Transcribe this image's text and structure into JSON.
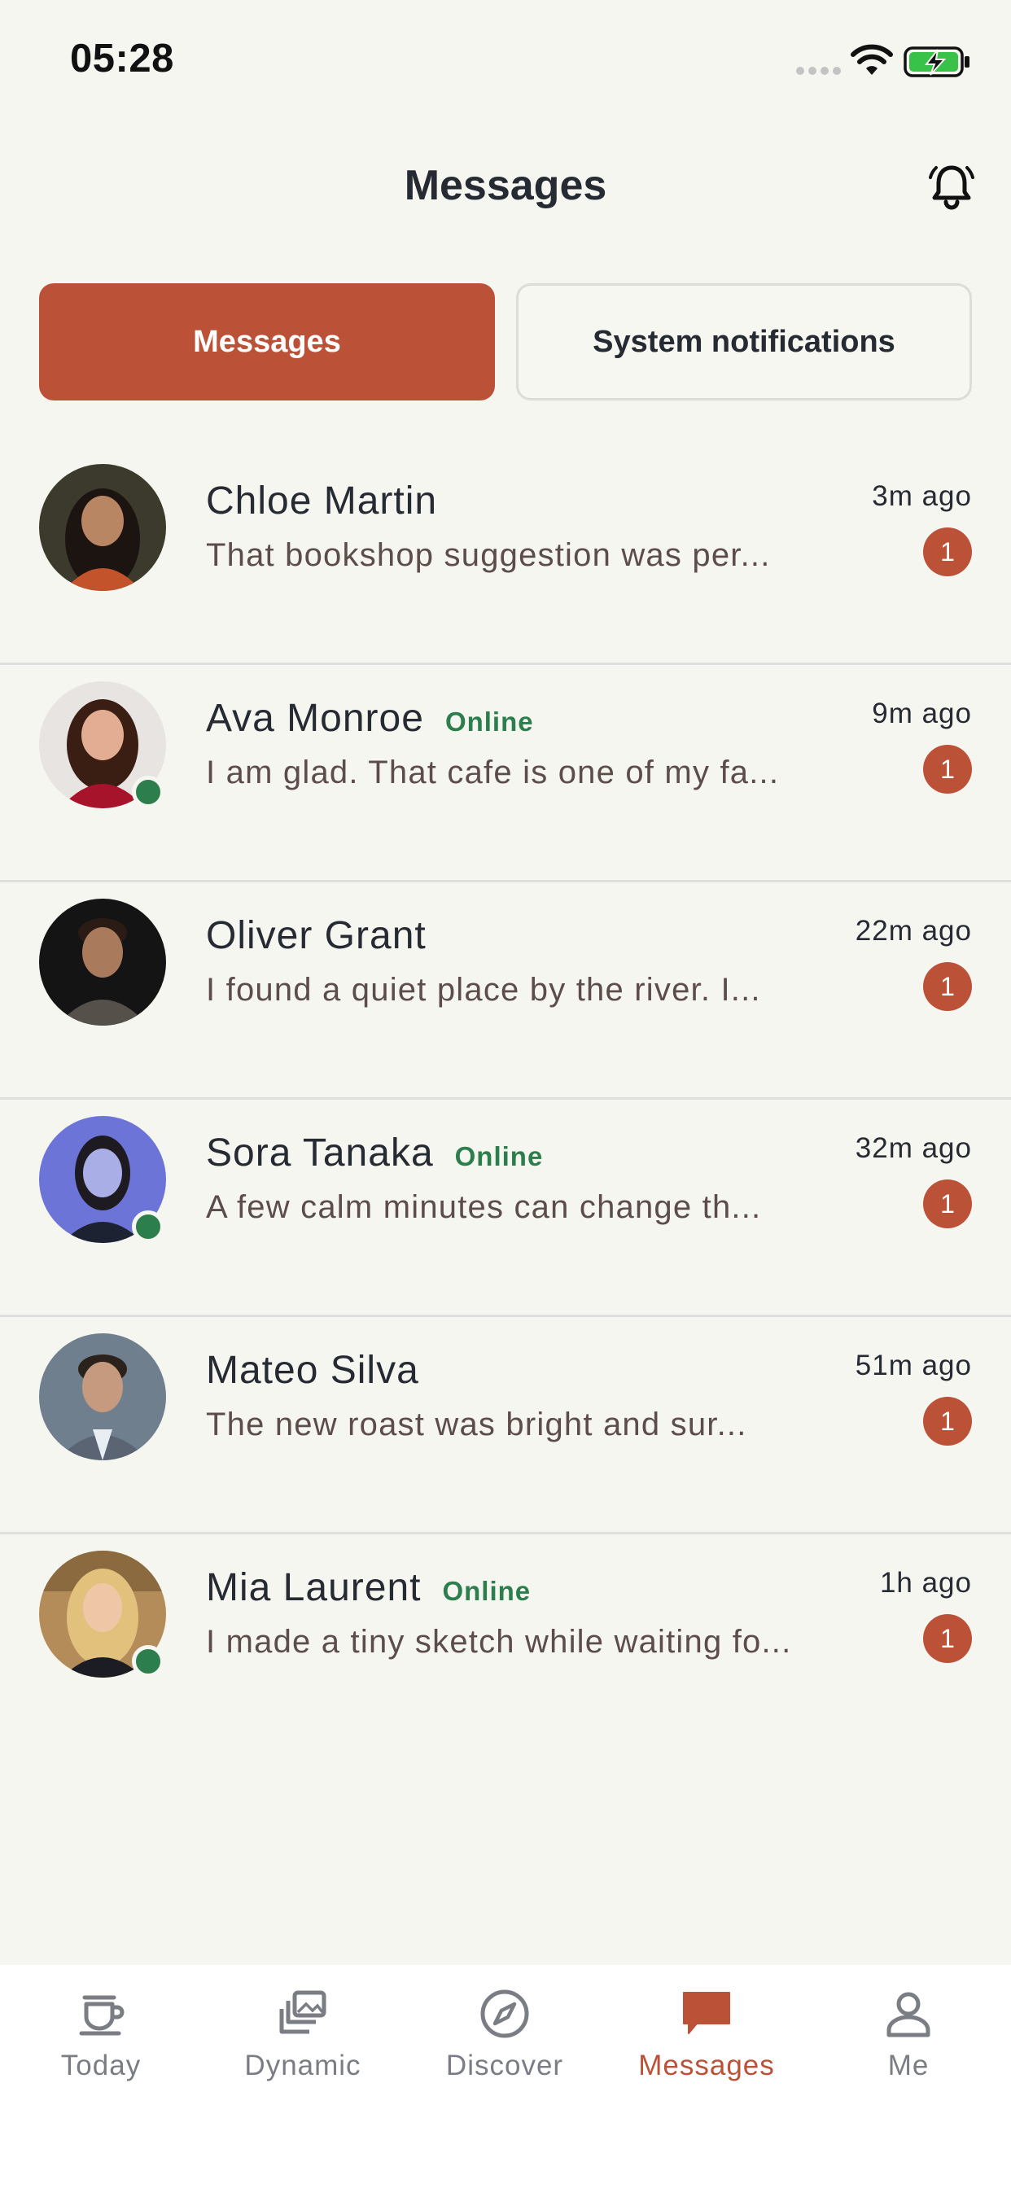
{
  "status_bar": {
    "time": "05:28"
  },
  "header": {
    "title": "Messages",
    "bell_icon": "bell-ringing-icon"
  },
  "tabs": [
    {
      "label": "Messages",
      "active": true
    },
    {
      "label": "System notifications",
      "active": false
    }
  ],
  "messages": [
    {
      "name": "Chloe Martin",
      "online": false,
      "online_label": "",
      "preview": "That bookshop suggestion was per...",
      "time": "3m ago",
      "unread": "1"
    },
    {
      "name": "Ava Monroe",
      "online": true,
      "online_label": "Online",
      "preview": "I am glad. That cafe is one of my fa...",
      "time": "9m ago",
      "unread": "1"
    },
    {
      "name": "Oliver Grant",
      "online": false,
      "online_label": "",
      "preview": "I found a quiet place by the river. I...",
      "time": "22m ago",
      "unread": "1"
    },
    {
      "name": "Sora Tanaka",
      "online": true,
      "online_label": "Online",
      "preview": "A few calm minutes can change th...",
      "time": "32m ago",
      "unread": "1"
    },
    {
      "name": "Mateo Silva",
      "online": false,
      "online_label": "",
      "preview": "The new roast was bright and sur...",
      "time": "51m ago",
      "unread": "1"
    },
    {
      "name": "Mia Laurent",
      "online": true,
      "online_label": "Online",
      "preview": "I made a tiny sketch while waiting fo...",
      "time": "1h ago",
      "unread": "1"
    }
  ],
  "bottom_nav": [
    {
      "label": "Today",
      "icon": "coffee-cup-icon",
      "active": false
    },
    {
      "label": "Dynamic",
      "icon": "stacked-photos-icon",
      "active": false
    },
    {
      "label": "Discover",
      "icon": "compass-icon",
      "active": false
    },
    {
      "label": "Messages",
      "icon": "chat-bubble-icon",
      "active": true
    },
    {
      "label": "Me",
      "icon": "person-icon",
      "active": false
    }
  ],
  "colors": {
    "accent": "#bb5238",
    "online": "#2c7f4d",
    "background": "#f6f6f1",
    "text": "#262b33"
  }
}
